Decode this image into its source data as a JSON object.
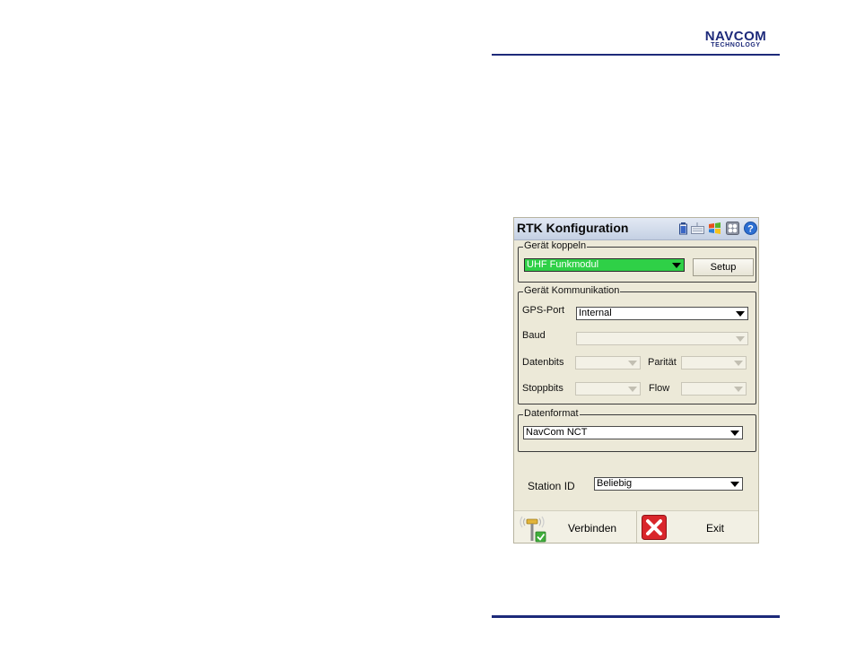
{
  "logo": {
    "line1": "NAVCOM",
    "line2": "TECHNOLOGY"
  },
  "app": {
    "title": "RTK Konfiguration",
    "titlebar_icons": [
      "battery-icon",
      "keyboard-icon",
      "windows-flag-icon",
      "settings-icon",
      "help-icon"
    ]
  },
  "geraet_koppeln": {
    "legend": "Gerät koppeln",
    "device_value": "UHF Funkmodul",
    "setup_label": "Setup"
  },
  "kommunikation": {
    "legend": "Gerät Kommunikation",
    "gps_port_label": "GPS-Port",
    "gps_port_value": "Internal",
    "baud_label": "Baud",
    "datenbits_label": "Datenbits",
    "paritaet_label": "Parität",
    "stoppbits_label": "Stoppbits",
    "flow_label": "Flow"
  },
  "datenformat": {
    "legend": "Datenformat",
    "value": "NavCom NCT"
  },
  "station": {
    "label": "Station ID",
    "value": "Beliebig"
  },
  "bottom": {
    "connect_label": "Verbinden",
    "exit_label": "Exit"
  },
  "colors": {
    "accent_blue": "#1d2a7a",
    "selected_green": "#2fd047",
    "screen_bg": "#ece9d8",
    "exit_red": "#d9262b"
  }
}
